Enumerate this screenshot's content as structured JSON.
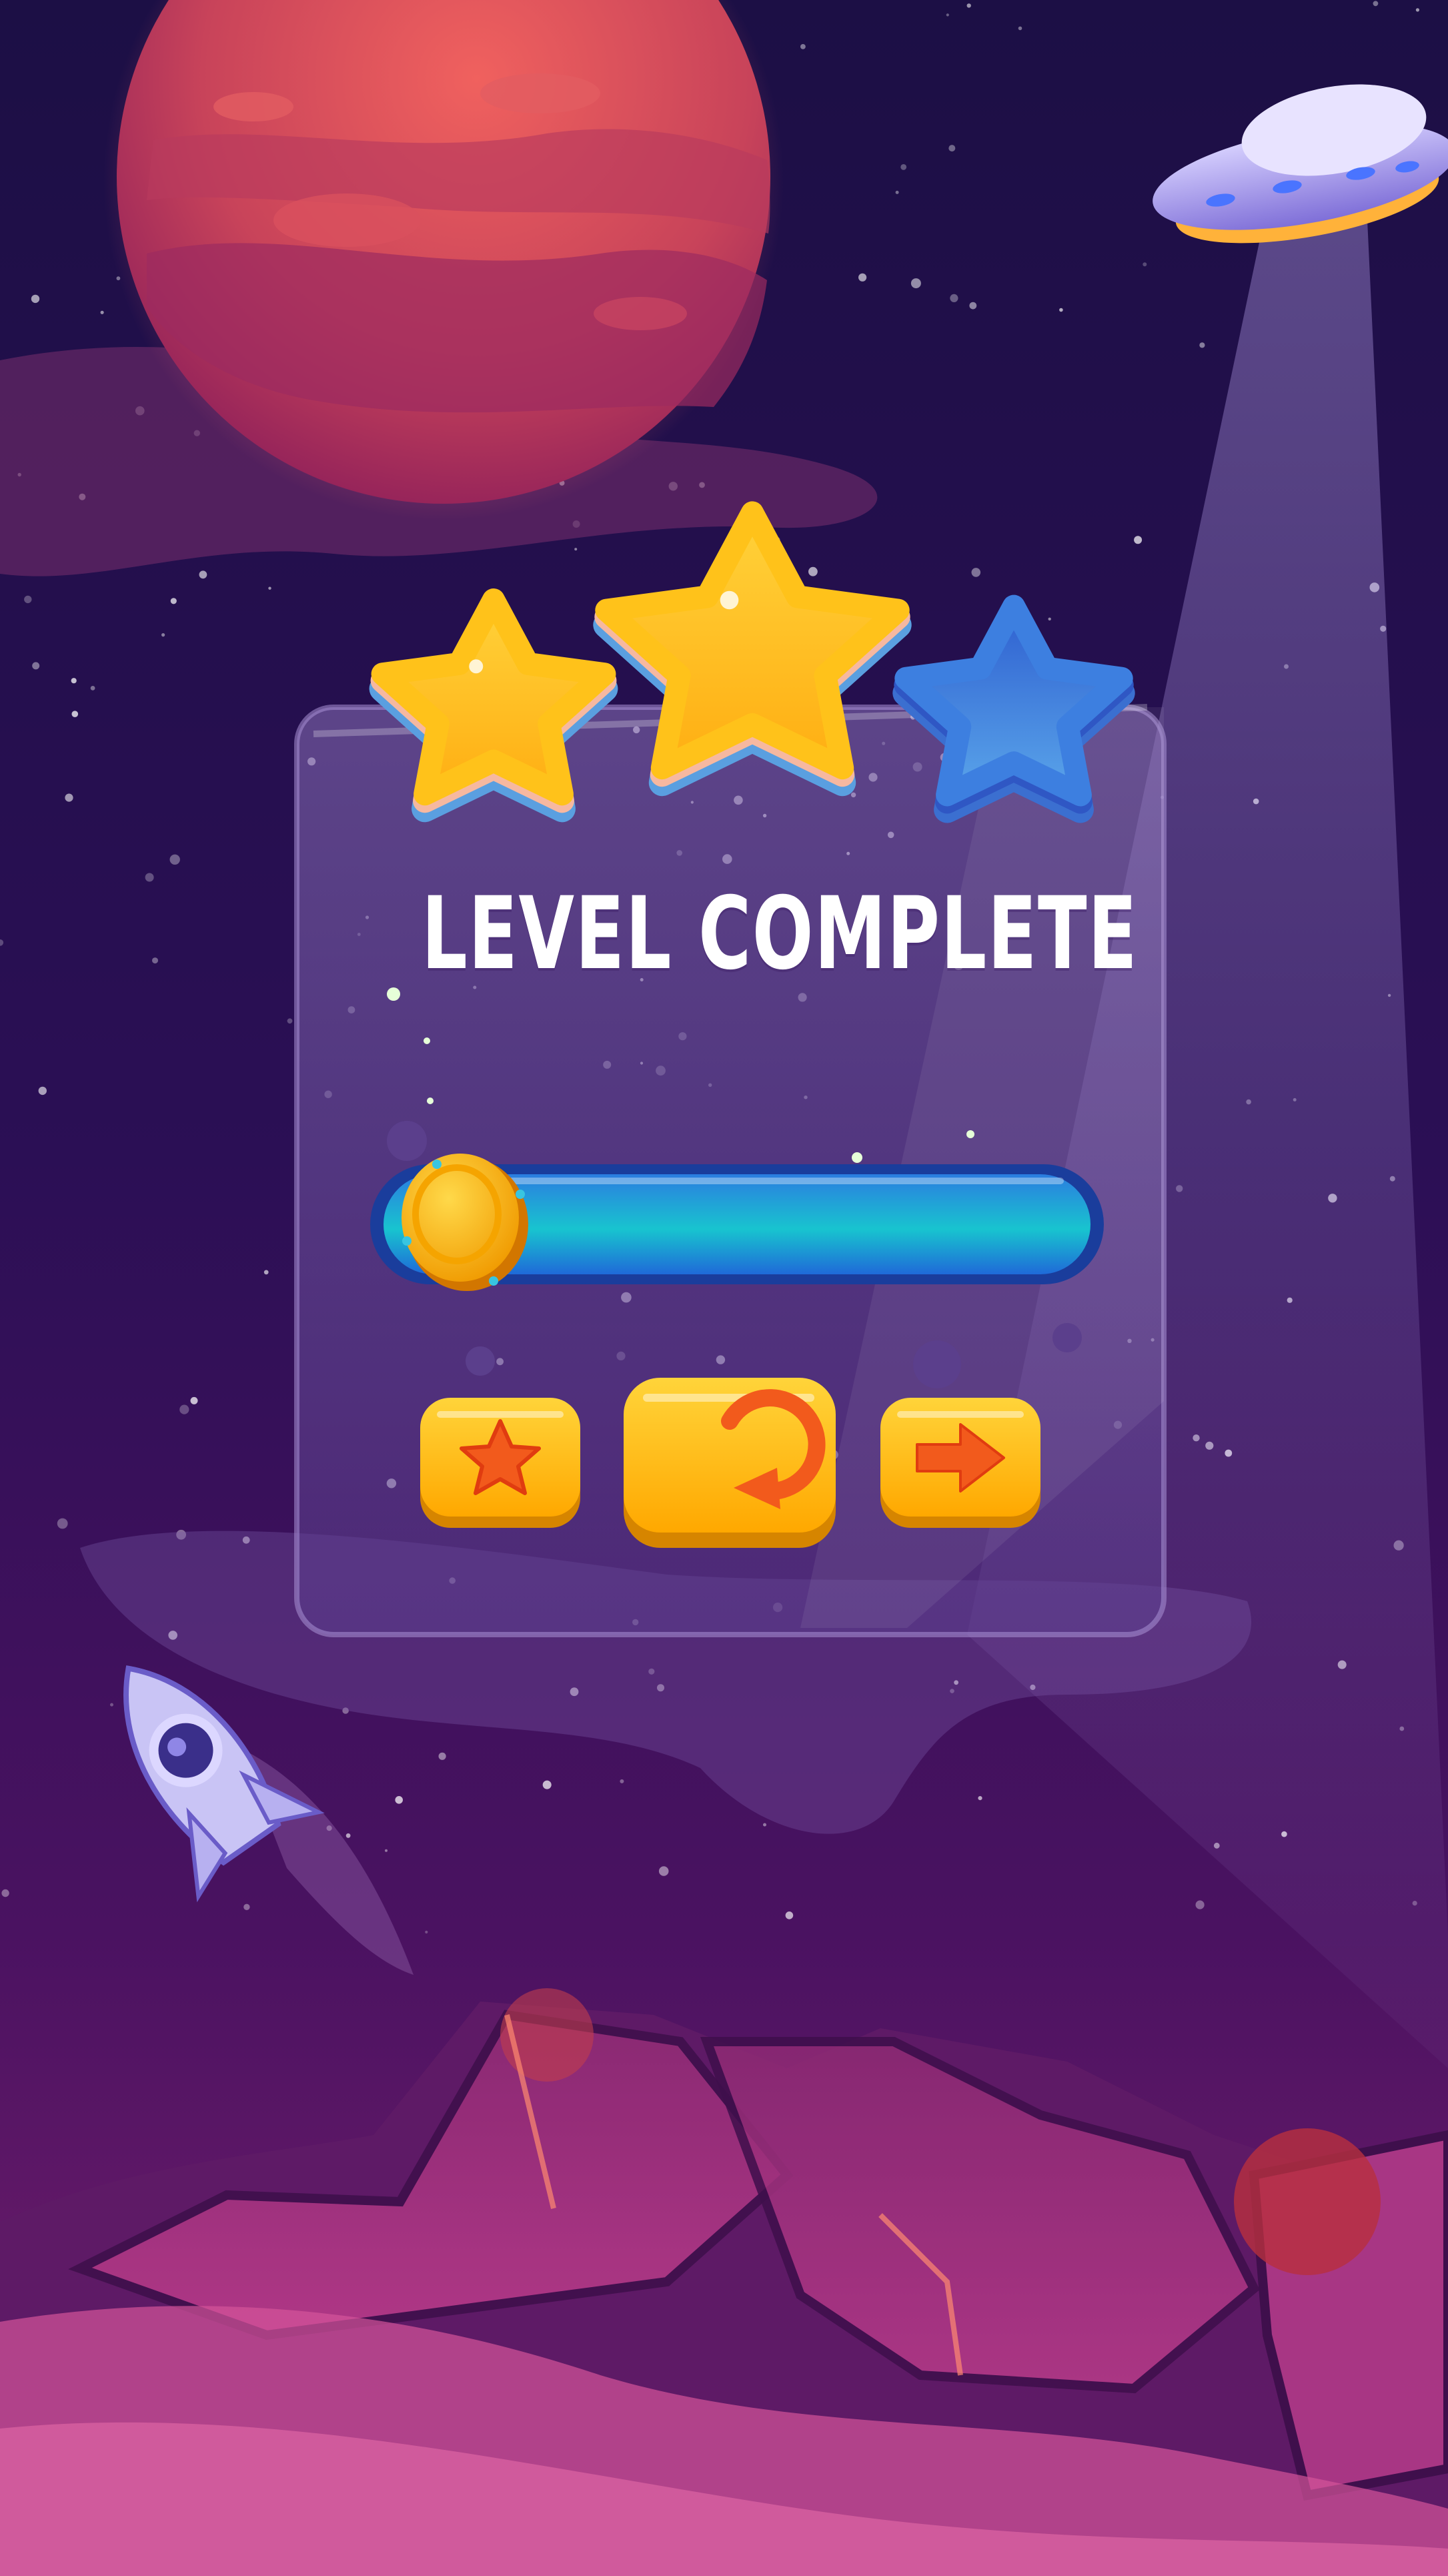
{
  "screen": {
    "title": "LEVEL COMPLETE"
  },
  "stars": {
    "earned": 2,
    "total": 3
  },
  "progress": {
    "fraction": 1.0
  },
  "buttons": [
    {
      "name": "rate-button",
      "icon": "star-icon"
    },
    {
      "name": "replay-button",
      "icon": "replay-icon"
    },
    {
      "name": "next-level-button",
      "icon": "arrow-right-icon"
    }
  ],
  "colors": {
    "space_top": "#1c0f45",
    "space_bottom": "#7a1f6e",
    "star_gold": "#ffc21a",
    "star_blue": "#3d7fe0",
    "button_gold": "#ffb400",
    "icon_orange": "#f25a1c",
    "progress_teal": "#1ec8d6",
    "coin_gold": "#ffb21a",
    "panel": "#6d4fa0"
  }
}
